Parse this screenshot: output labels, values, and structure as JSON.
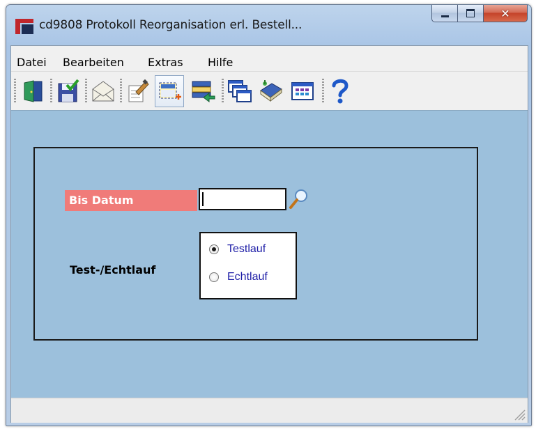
{
  "window": {
    "title": "cd9808 Protokoll Reorganisation erl. Bestell...",
    "caption_buttons": [
      "minimize-icon",
      "maximize-icon",
      "close-icon"
    ]
  },
  "menu": {
    "items": [
      "Datei",
      "Bearbeiten",
      "Extras",
      "Hilfe"
    ]
  },
  "toolbar": {
    "buttons": [
      {
        "icon": "exit-door-icon"
      },
      {
        "icon": "save-disk-icon"
      },
      {
        "icon": "mail-envelope-icon"
      },
      {
        "icon": "edit-document-icon"
      },
      {
        "icon": "new-selection-icon",
        "pressed": true
      },
      {
        "icon": "list-import-icon"
      },
      {
        "icon": "windows-cascade-icon"
      },
      {
        "icon": "book-icon"
      },
      {
        "icon": "grid-table-icon"
      },
      {
        "icon": "help-question-icon"
      }
    ]
  },
  "form": {
    "bis_datum_label": "Bis Datum",
    "bis_datum_value": "",
    "test_echtlauf_label": "Test-/Echtlauf",
    "radio_options": [
      {
        "label": "Testlauf",
        "selected": true
      },
      {
        "label": "Echtlauf",
        "selected": false
      }
    ]
  },
  "colors": {
    "content_bg": "#9cc0dc",
    "label_highlight": "#f07b79",
    "radio_text": "#1c1ca6"
  }
}
